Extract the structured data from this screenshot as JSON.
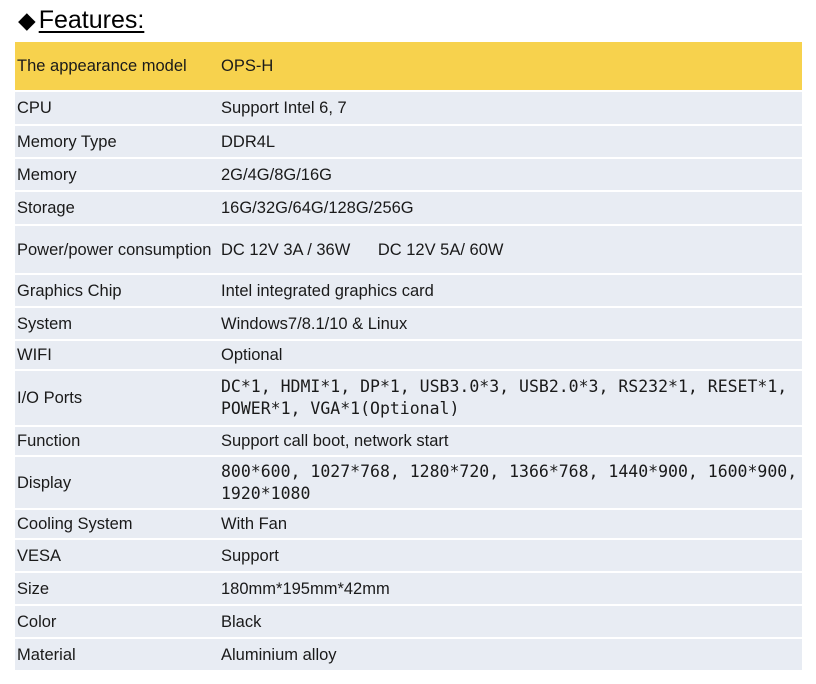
{
  "heading": {
    "text": "Features:"
  },
  "table": {
    "header": {
      "label": "The appearance model",
      "value": "OPS-H"
    },
    "rows": [
      {
        "label": "CPU",
        "value": "Support Intel 6, 7"
      },
      {
        "label": "Memory Type",
        "value": "DDR4L"
      },
      {
        "label": "Memory",
        "value": "2G/4G/8G/16G"
      },
      {
        "label": "Storage",
        "value": "16G/32G/64G/128G/256G"
      },
      {
        "label": "Power/power consumption",
        "value": "DC 12V 3A / 36W      DC 12V 5A/ 60W"
      },
      {
        "label": "Graphics Chip",
        "value": "Intel integrated graphics card"
      },
      {
        "label": "System",
        "value": "Windows7/8.1/10 & Linux"
      },
      {
        "label": "WIFI",
        "value": "Optional"
      },
      {
        "label": "I/O Ports",
        "value": "DC*1, HDMI*1, DP*1, USB3.0*3, USB2.0*3, RS232*1, RESET*1, POWER*1, VGA*1(Optional)"
      },
      {
        "label": "Function",
        "value": "Support call boot, network start"
      },
      {
        "label": "Display",
        "value": "800*600, 1027*768, 1280*720, 1366*768, 1440*900, 1600*900, 1920*1080"
      },
      {
        "label": "Cooling System",
        "value": "With Fan"
      },
      {
        "label": "VESA",
        "value": "Support"
      },
      {
        "label": "Size",
        "value": "180mm*195mm*42mm"
      },
      {
        "label": "Color",
        "value": "Black"
      },
      {
        "label": "Material",
        "value": "Aluminium alloy"
      }
    ]
  },
  "colors": {
    "header_bg": "#f7d24d",
    "row_bg": "#e8ecf3"
  }
}
